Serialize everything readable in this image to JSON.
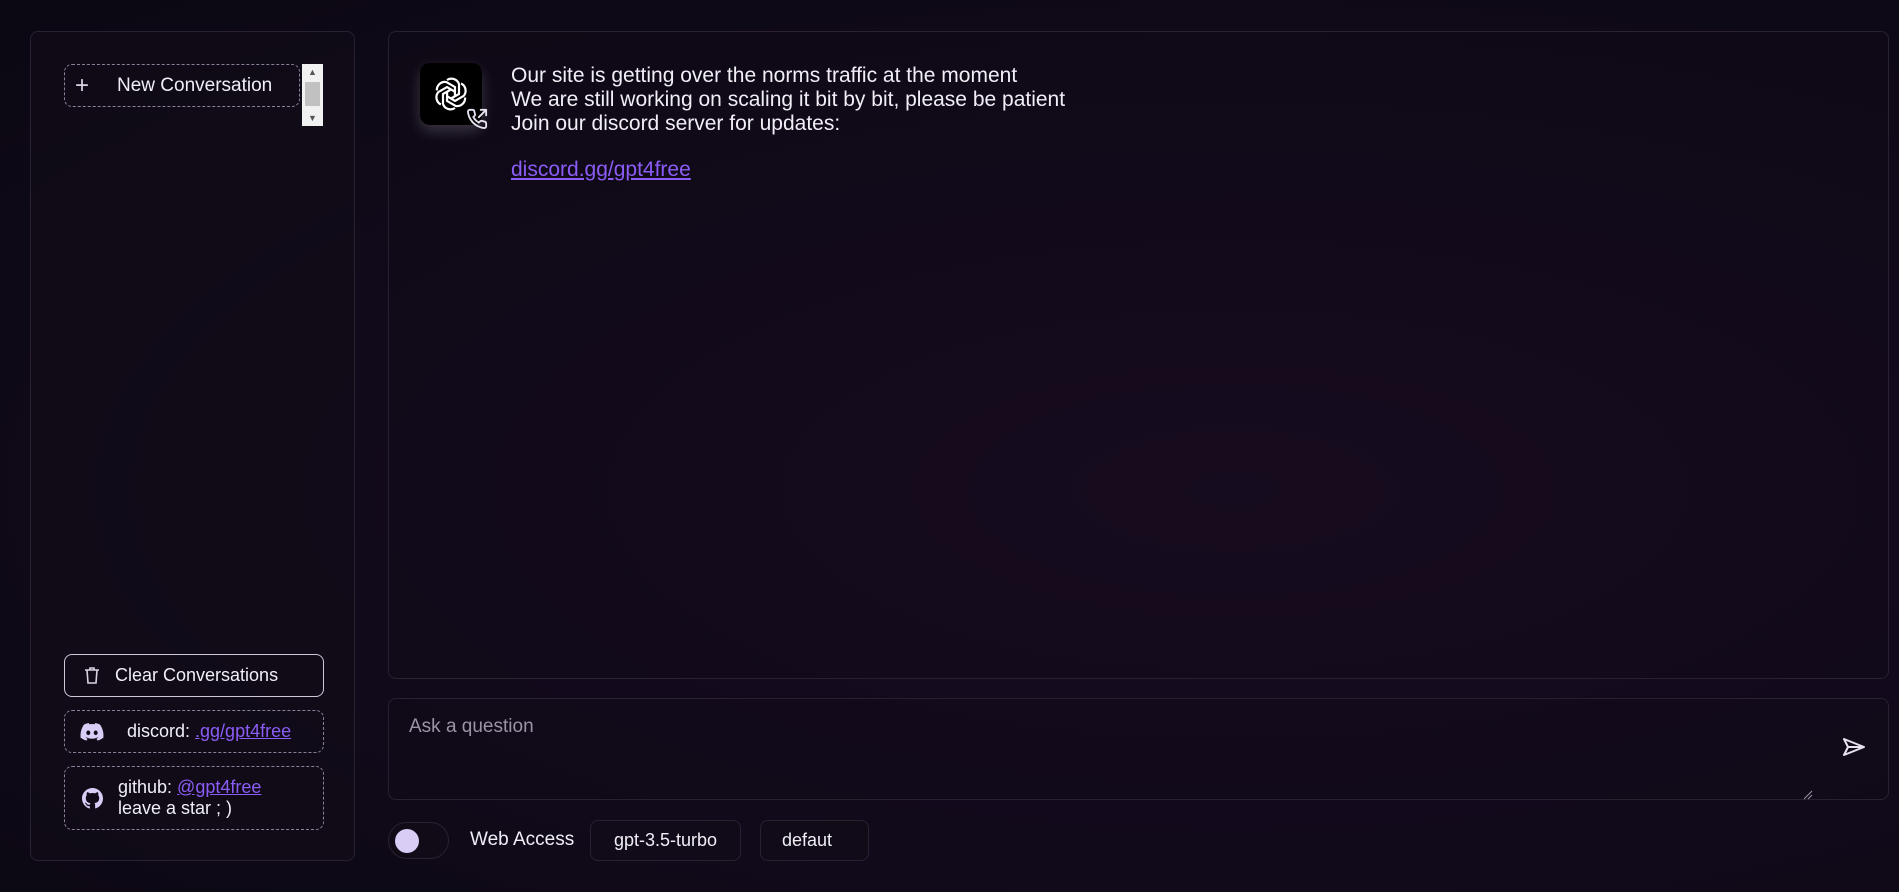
{
  "sidebar": {
    "new_conversation_label": "New Conversation",
    "clear_conversations_label": "Clear Conversations",
    "discord": {
      "prefix": "discord: ",
      "link_text": ".gg/gpt4free"
    },
    "github": {
      "prefix": "github: ",
      "link_text": "@gpt4free",
      "line2": "leave a star ; )"
    }
  },
  "message": {
    "line1": "Our site is getting over the norms traffic at the moment",
    "line2": "We are still working on scaling it bit by bit, please be patient",
    "line3": "Join our discord server for updates:",
    "link_text": "discord.gg/gpt4free"
  },
  "input": {
    "placeholder": "Ask a question",
    "value": ""
  },
  "controls": {
    "web_access_label": "Web Access",
    "web_access_on": false,
    "model_selected": "gpt-3.5-turbo",
    "jailbreak_selected": "defaut"
  },
  "colors": {
    "accent": "#8b5cf6",
    "background": "#120a1c"
  },
  "icons": [
    "plus-icon",
    "trash-icon",
    "discord-icon",
    "github-icon",
    "openai-logo-icon",
    "phone-call-icon",
    "send-icon"
  ]
}
